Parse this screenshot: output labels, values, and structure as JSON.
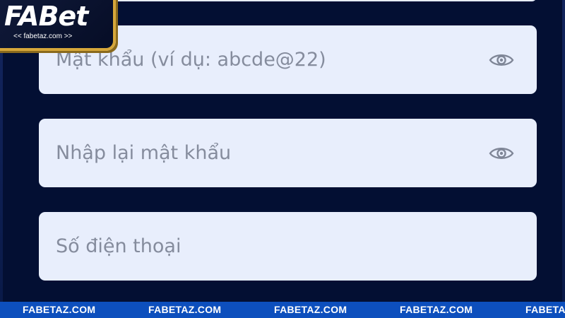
{
  "logo": {
    "brand": "FABet",
    "tagline": "<< fabetaz.com >>"
  },
  "form": {
    "password_placeholder": "Mật khẩu (ví dụ: abcde@22)",
    "confirm_password_placeholder": "Nhập lại mật khẩu",
    "phone_placeholder": "Số điện thoại"
  },
  "footer": {
    "items": [
      "FABETAZ.COM",
      "FABETAZ.COM",
      "FABETAZ.COM",
      "FABETAZ.COM",
      "FABETAZ.COM"
    ]
  },
  "colors": {
    "background": "#030f33",
    "field_bg": "#e8eefc",
    "placeholder": "#858c9d",
    "ticker_bg": "#0d4fbd",
    "logo_gold": "#d6a73a"
  },
  "icons": {
    "password_toggle": "eye-icon"
  }
}
